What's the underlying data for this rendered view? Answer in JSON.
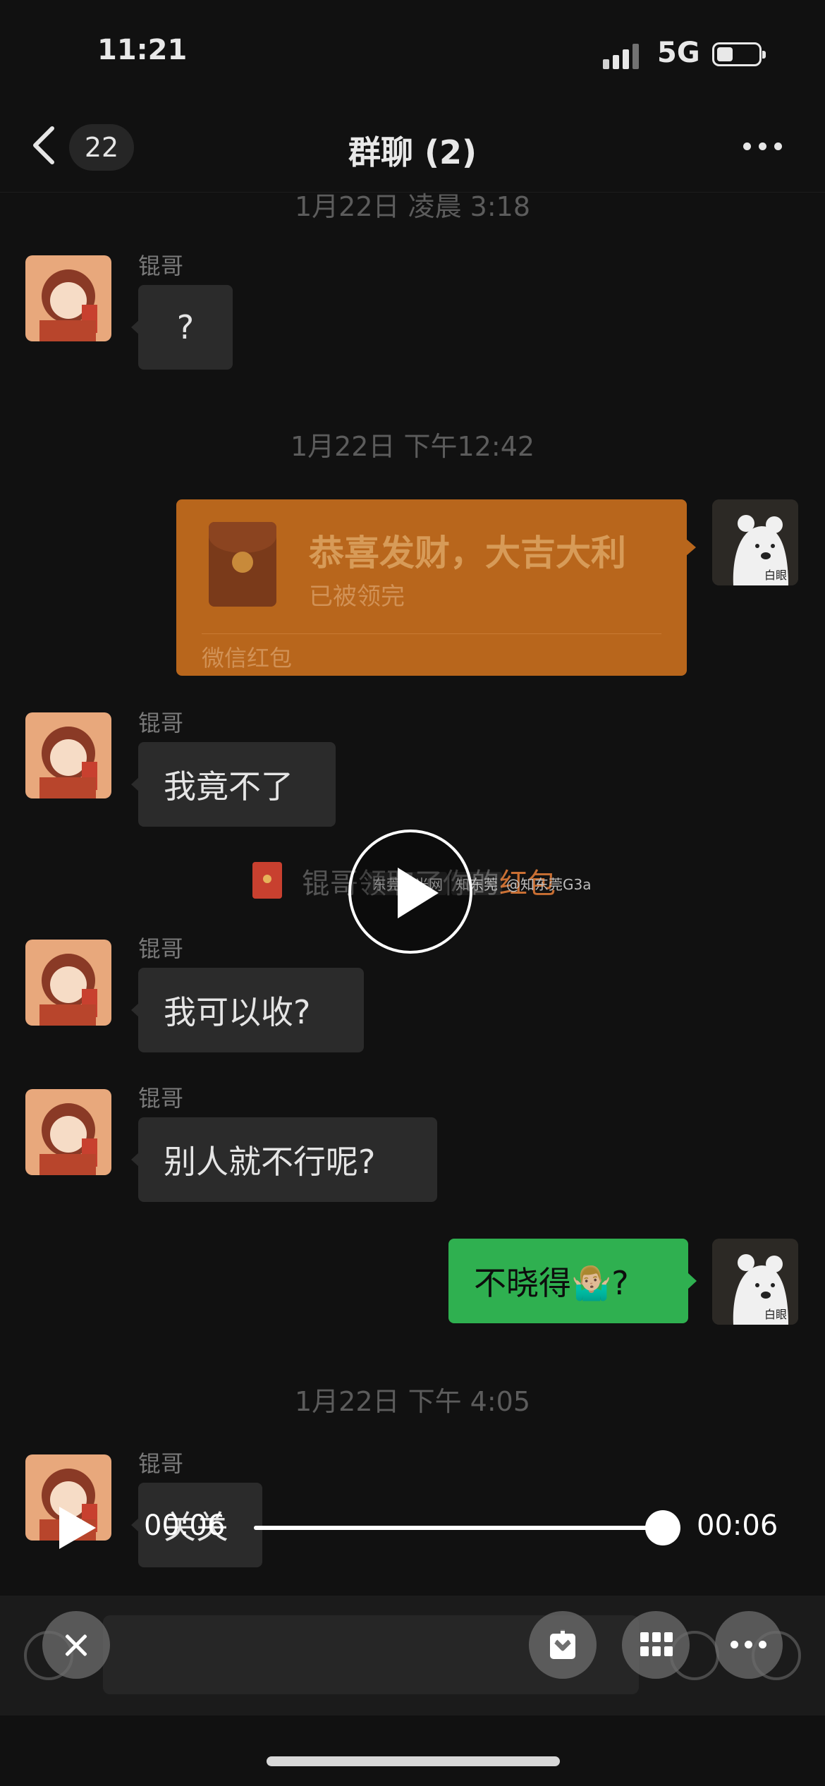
{
  "status_bar": {
    "time": "11:21",
    "network": "5G",
    "signal_icon": "signal-bars-icon",
    "battery_icon": "battery-icon"
  },
  "nav": {
    "back_icon": "chevron-left-icon",
    "unread_badge": "22",
    "title": "群聊 (2)",
    "more_icon": "ellipsis-icon"
  },
  "messages": {
    "ts_top": "1月22日 凌晨 3:18",
    "m1": {
      "sender": "锟哥",
      "text": "?"
    },
    "ts_1242": "1月22日 下午12:42",
    "red_packet": {
      "title": "恭喜发财，大吉大利",
      "status": "已被领完",
      "footer": "微信红包",
      "icon": "red-envelope-icon"
    },
    "m2": {
      "sender": "锟哥",
      "text": "我竟不了"
    },
    "system": {
      "prefix": "锟哥领取了你的",
      "link": "红包"
    },
    "m3": {
      "sender": "锟哥",
      "text": "我可以收?"
    },
    "m4": {
      "sender": "锟哥",
      "text": "别人就不行呢?"
    },
    "m5_self": {
      "text": "不晓得🤷🏼‍♂️?"
    },
    "ts_405": "1月22日 下午 4:05",
    "m6": {
      "sender": "锟哥",
      "text": "关关"
    },
    "self_avatar_label": "白眼"
  },
  "watermark": {
    "brand1": "东莞阳光网",
    "brand2": "知东莞",
    "handle": "@知东莞G3a"
  },
  "player": {
    "current_time": "00:06",
    "total_time": "00:06",
    "progress": 1.0
  },
  "actions": {
    "close_icon": "close-icon",
    "download_icon": "download-icon",
    "grid_icon": "grid-icon",
    "more_icon": "more-dots-icon"
  },
  "colors": {
    "background": "#111111",
    "incoming_bubble": "#2b2b2b",
    "outgoing_bubble": "#2fb050",
    "red_packet": "#b8661c",
    "link": "#c96f33"
  }
}
